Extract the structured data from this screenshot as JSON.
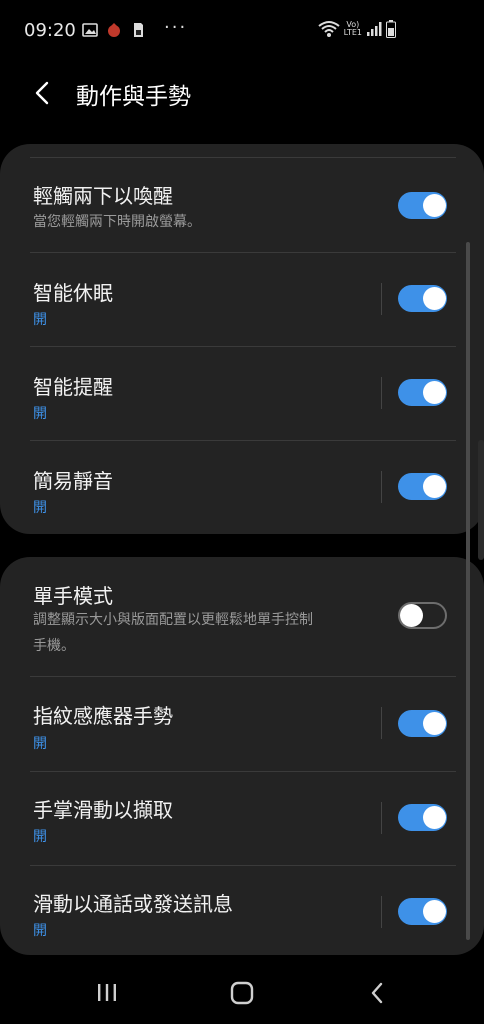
{
  "status_bar": {
    "time": "09:20",
    "dots": "···",
    "volte_top": "Vo)",
    "volte_bottom": "LTE1",
    "icons": [
      "gallery-icon",
      "app-notification-icon",
      "sim-icon",
      "wifi-icon",
      "signal-icon",
      "battery-icon"
    ]
  },
  "header": {
    "title": "動作與手勢",
    "back_icon": "back-arrow-icon"
  },
  "group1": [
    {
      "title": "輕觸兩下以喚醒",
      "subtitle": "當您輕觸兩下時開啟螢幕。",
      "toggle": "on"
    },
    {
      "title": "智能休眠",
      "subtitle": "開",
      "toggle": "on"
    },
    {
      "title": "智能提醒",
      "subtitle": "開",
      "toggle": "on"
    },
    {
      "title": "簡易靜音",
      "subtitle": "開",
      "toggle": "on"
    }
  ],
  "group2": [
    {
      "title": "單手模式",
      "subtitle_line1": "調整顯示大小與版面配置以更輕鬆地單手控制",
      "subtitle_line2": "手機。",
      "toggle": "off"
    },
    {
      "title": "指紋感應器手勢",
      "subtitle": "開",
      "toggle": "on"
    },
    {
      "title": "手掌滑動以擷取",
      "subtitle": "開",
      "toggle": "on"
    },
    {
      "title": "滑動以通話或發送訊息",
      "subtitle": "開",
      "toggle": "on"
    }
  ],
  "navbar": {
    "icons": [
      "recents-icon",
      "home-icon",
      "back-icon"
    ]
  },
  "colors": {
    "accent": "#3e91e8",
    "card": "#232323",
    "background": "#000000"
  }
}
